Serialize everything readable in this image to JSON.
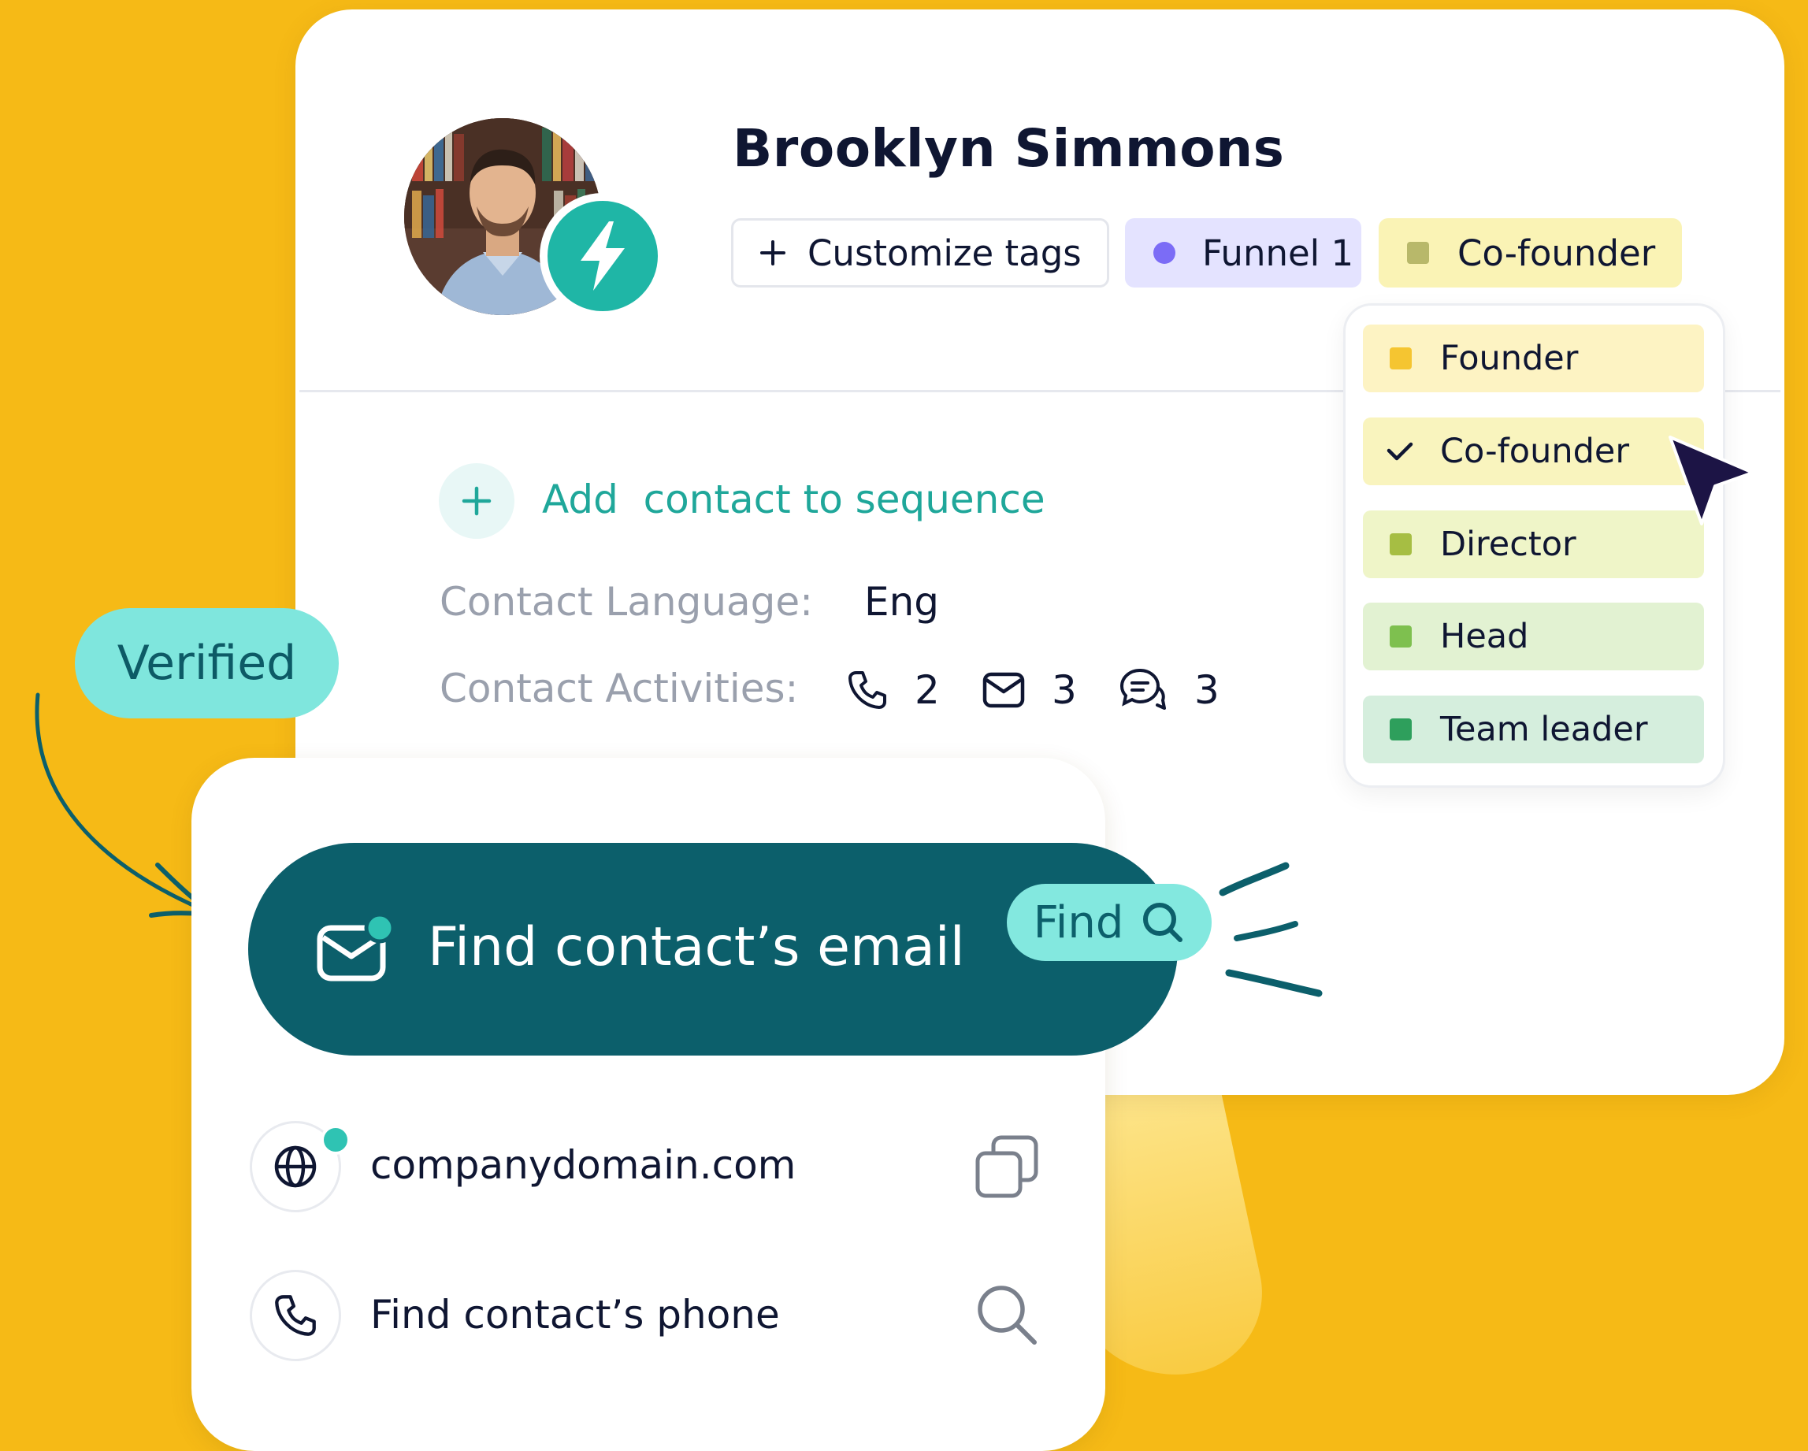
{
  "profile": {
    "name": "Brooklyn Simmons",
    "avatar_alt": "",
    "badge_icon": "lightning-icon"
  },
  "tags": {
    "customize_label": "Customize tags",
    "funnel_label": "Funnel 1",
    "selected_role": "Co-founder"
  },
  "role_dropdown": {
    "items": [
      {
        "label": "Founder",
        "color": "#F5C531",
        "bg": "#FDF3C3",
        "checked": false
      },
      {
        "label": "Co-founder",
        "color": "#B8B86A",
        "bg": "#F9F4BE",
        "checked": true
      },
      {
        "label": "Director",
        "color": "#A6BE43",
        "bg": "#EFF5C8",
        "checked": false
      },
      {
        "label": "Head",
        "color": "#7EC04F",
        "bg": "#E2F2D2",
        "checked": false
      },
      {
        "label": "Team leader",
        "color": "#2E9F5C",
        "bg": "#D5EEDD",
        "checked": false
      }
    ]
  },
  "sequence": {
    "add_label": "Add  contact to sequence"
  },
  "contact": {
    "language_label": "Contact Language:",
    "language_value": "Eng",
    "activities_label": "Contact Activities:",
    "calls": "2",
    "emails": "3",
    "messages": "3"
  },
  "verified_label": "Verified",
  "finder": {
    "email_label": "Find contact’s email",
    "find_button": "Find",
    "domain": "companydomain.com",
    "phone_label": "Find contact’s phone"
  },
  "colors": {
    "background": "#F6BA16",
    "teal_dark": "#0C5F6B",
    "teal_light": "#83E8DF",
    "accent_green": "#1FA79A",
    "funnel_dot": "#7B6CF6"
  }
}
